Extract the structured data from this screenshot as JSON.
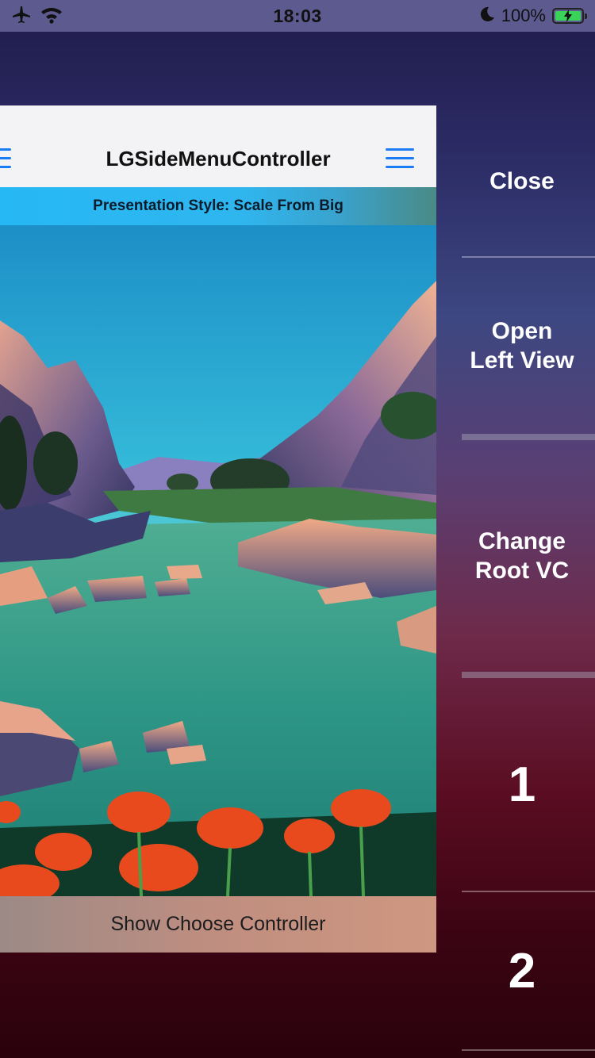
{
  "status_bar": {
    "time": "18:03",
    "battery_percent": "100%",
    "icons": [
      "airplane-icon",
      "wifi-icon",
      "moon-icon",
      "battery-charging-icon"
    ]
  },
  "root_view": {
    "nav_title": "LGSideMenuController",
    "presentation_style": "Presentation Style: Scale From Big",
    "bottom_button": "Show Choose Controller"
  },
  "right_menu": {
    "items": [
      {
        "label": "Close"
      },
      {
        "label": "Open\nLeft View"
      },
      {
        "label": "Change\nRoot VC"
      },
      {
        "label": "1"
      },
      {
        "label": "2"
      }
    ]
  },
  "colors": {
    "accent_blue": "#1a7cf2",
    "battery_green": "#3ad35a",
    "band_blue": "#26b8f5"
  }
}
